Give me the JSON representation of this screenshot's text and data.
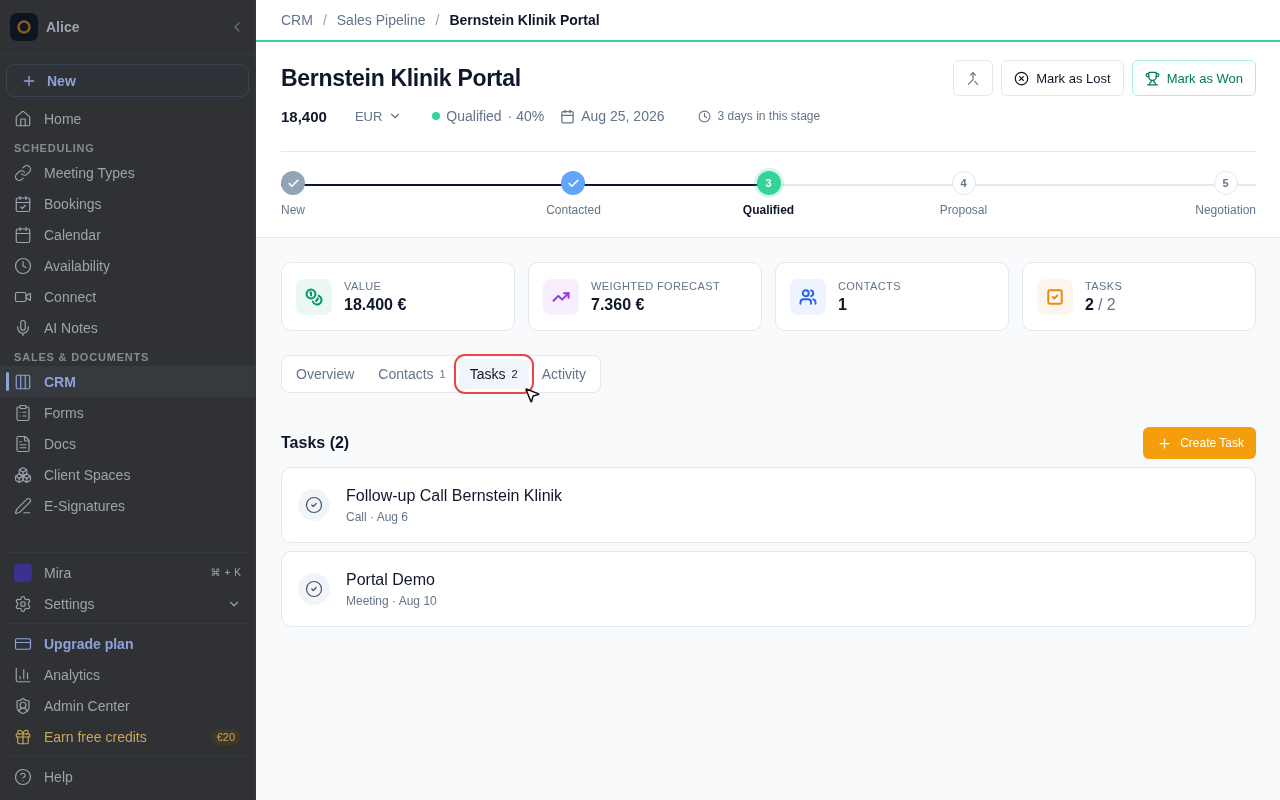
{
  "sidebar": {
    "workspace": "Alice",
    "new_button": "New",
    "items": [
      {
        "kind": "item",
        "label": "Home",
        "selected": false
      },
      {
        "kind": "section",
        "label": "SCHEDULING"
      },
      {
        "kind": "item",
        "label": "Meeting Types",
        "selected": false
      },
      {
        "kind": "item",
        "label": "Bookings",
        "selected": false
      },
      {
        "kind": "item",
        "label": "Calendar",
        "selected": false
      },
      {
        "kind": "item",
        "label": "Availability",
        "selected": false
      },
      {
        "kind": "item",
        "label": "Connect",
        "selected": false
      },
      {
        "kind": "item",
        "label": "AI Notes",
        "selected": false
      },
      {
        "kind": "section",
        "label": "SALES & DOCUMENTS"
      },
      {
        "kind": "item",
        "label": "CRM",
        "selected": true
      },
      {
        "kind": "item",
        "label": "Forms",
        "selected": false
      },
      {
        "kind": "item",
        "label": "Docs",
        "selected": false
      },
      {
        "kind": "item",
        "label": "Client Spaces",
        "selected": false
      },
      {
        "kind": "item",
        "label": "E-Signatures",
        "selected": false
      }
    ],
    "assistant": {
      "label": "Mira",
      "shortcut": [
        "⌘",
        "+",
        "K"
      ]
    },
    "settings": "Settings",
    "footer": [
      {
        "label": "Upgrade plan",
        "kind": "upgrade"
      },
      {
        "label": "Analytics",
        "kind": "item"
      },
      {
        "label": "Admin Center",
        "kind": "item"
      },
      {
        "label": "Earn free credits",
        "kind": "credits",
        "badge": "€20"
      }
    ],
    "help": "Help"
  },
  "breadcrumb": [
    {
      "kind": "link",
      "text": "CRM"
    },
    {
      "kind": "separator",
      "text": "/"
    },
    {
      "kind": "link",
      "text": "Sales Pipeline"
    },
    {
      "kind": "separator",
      "text": "/"
    },
    {
      "kind": "current",
      "text": "Bernstein Klinik Portal"
    }
  ],
  "deal": {
    "title": "Bernstein Klinik Portal",
    "amount": "18,400",
    "currency": "EUR",
    "stage": "Qualified",
    "probability": "· 40%",
    "close_date": "Aug 25, 2026",
    "time_in_stage": "3 days in this stage"
  },
  "actions": {
    "lost": "Mark as Lost",
    "won": "Mark as Won"
  },
  "pipeline": [
    {
      "label": "New",
      "completed": true,
      "selected": false,
      "color": "#94a3b8"
    },
    {
      "label": "Contacted",
      "completed": true,
      "selected": false,
      "color": "#60a5fa"
    },
    {
      "label": "Qualified",
      "marker": "3",
      "completed": false,
      "selected": true,
      "color": "#34d399"
    },
    {
      "label": "Proposal",
      "marker": "4",
      "completed": false,
      "selected": false,
      "color": "#e2e8f0"
    },
    {
      "label": "Negotiation",
      "marker": "5",
      "completed": false,
      "selected": false,
      "color": "#e2e8f0"
    }
  ],
  "stats": [
    {
      "label": "VALUE",
      "value": "18.400 €",
      "color": "#059669"
    },
    {
      "label": "WEIGHTED FORECAST",
      "value": "7.360 €",
      "color": "#9333ea"
    },
    {
      "label": "CONTACTS",
      "value": "1",
      "color": "#2563eb"
    },
    {
      "label": "TASKS",
      "value": "2",
      "total": "/ 2",
      "color": "#ea8a0c"
    }
  ],
  "tabs": [
    {
      "label": "Overview",
      "selected": false,
      "highlighted": false
    },
    {
      "label": "Contacts",
      "count": "1",
      "selected": false,
      "highlighted": false
    },
    {
      "label": "Tasks",
      "count": "2",
      "selected": true,
      "highlighted": true
    },
    {
      "label": "Activity",
      "selected": false,
      "highlighted": false
    }
  ],
  "tasks_heading": "Tasks (2)",
  "create_button": "Create Task",
  "tasks": [
    {
      "title": "Follow-up Call Bernstein Klinik",
      "meta": "Call · Aug 6"
    },
    {
      "title": "Portal Demo",
      "meta": "Meeting · Aug 10"
    }
  ]
}
